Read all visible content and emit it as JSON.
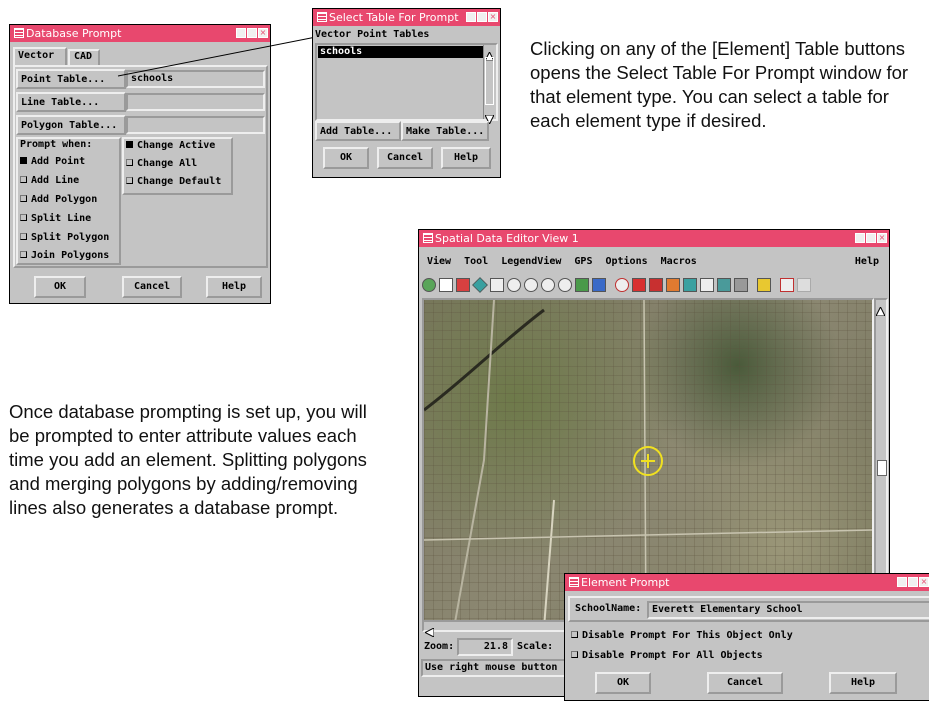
{
  "db_prompt": {
    "title": "Database Prompt",
    "tabs": [
      "Vector",
      "CAD"
    ],
    "point_table_label": "Point Table...",
    "point_table_value": "schools",
    "line_table_label": "Line Table...",
    "line_table_value": "",
    "polygon_table_label": "Polygon Table...",
    "polygon_table_value": "",
    "prompt_when_label": "Prompt when:",
    "prompt_options": [
      {
        "label": "Add Point",
        "checked": true
      },
      {
        "label": "Add Line",
        "checked": false
      },
      {
        "label": "Add Polygon",
        "checked": false
      },
      {
        "label": "Split Line",
        "checked": false
      },
      {
        "label": "Split Polygon",
        "checked": false
      },
      {
        "label": "Join Polygons",
        "checked": false
      }
    ],
    "change_options": [
      {
        "label": "Change Active",
        "checked": true
      },
      {
        "label": "Change All",
        "checked": false
      },
      {
        "label": "Change Default",
        "checked": false
      }
    ],
    "ok": "OK",
    "cancel": "Cancel",
    "help": "Help"
  },
  "select_table": {
    "title": "Select Table For Prompt",
    "list_header": "Vector Point Tables",
    "items": [
      "schools"
    ],
    "add_table": "Add Table...",
    "make_table": "Make Table...",
    "ok": "OK",
    "cancel": "Cancel",
    "help": "Help"
  },
  "caption_top": "Clicking on any of the [Element] Table buttons opens the Select Table For Prompt window for that element type.  You can select a table for each element type if desired.",
  "caption_bottom": "Once database prompting is set up, you will be prompted to enter attribute values each time you add an element.  Splitting polygons and merging polygons by adding/removing lines also generates a database prompt.",
  "editor": {
    "title": "Spatial Data Editor View 1",
    "menu": [
      "View",
      "Tool",
      "LegendView",
      "GPS",
      "Options",
      "Macros"
    ],
    "menu_help": "Help",
    "zoom_label": "Zoom:",
    "zoom_value": "21.8",
    "scale_label": "Scale:",
    "status": "Use right mouse button"
  },
  "element_prompt": {
    "title": "Element Prompt",
    "field_label": "SchoolName:",
    "field_value": "Everett Elementary School",
    "disable_object": "Disable Prompt For This Object Only",
    "disable_all": "Disable Prompt For All Objects",
    "ok": "OK",
    "cancel": "Cancel",
    "help": "Help"
  },
  "colors": {
    "titlebar": "#e8486e",
    "window_bg": "#c4c4c4",
    "marker": "#f0e020"
  }
}
